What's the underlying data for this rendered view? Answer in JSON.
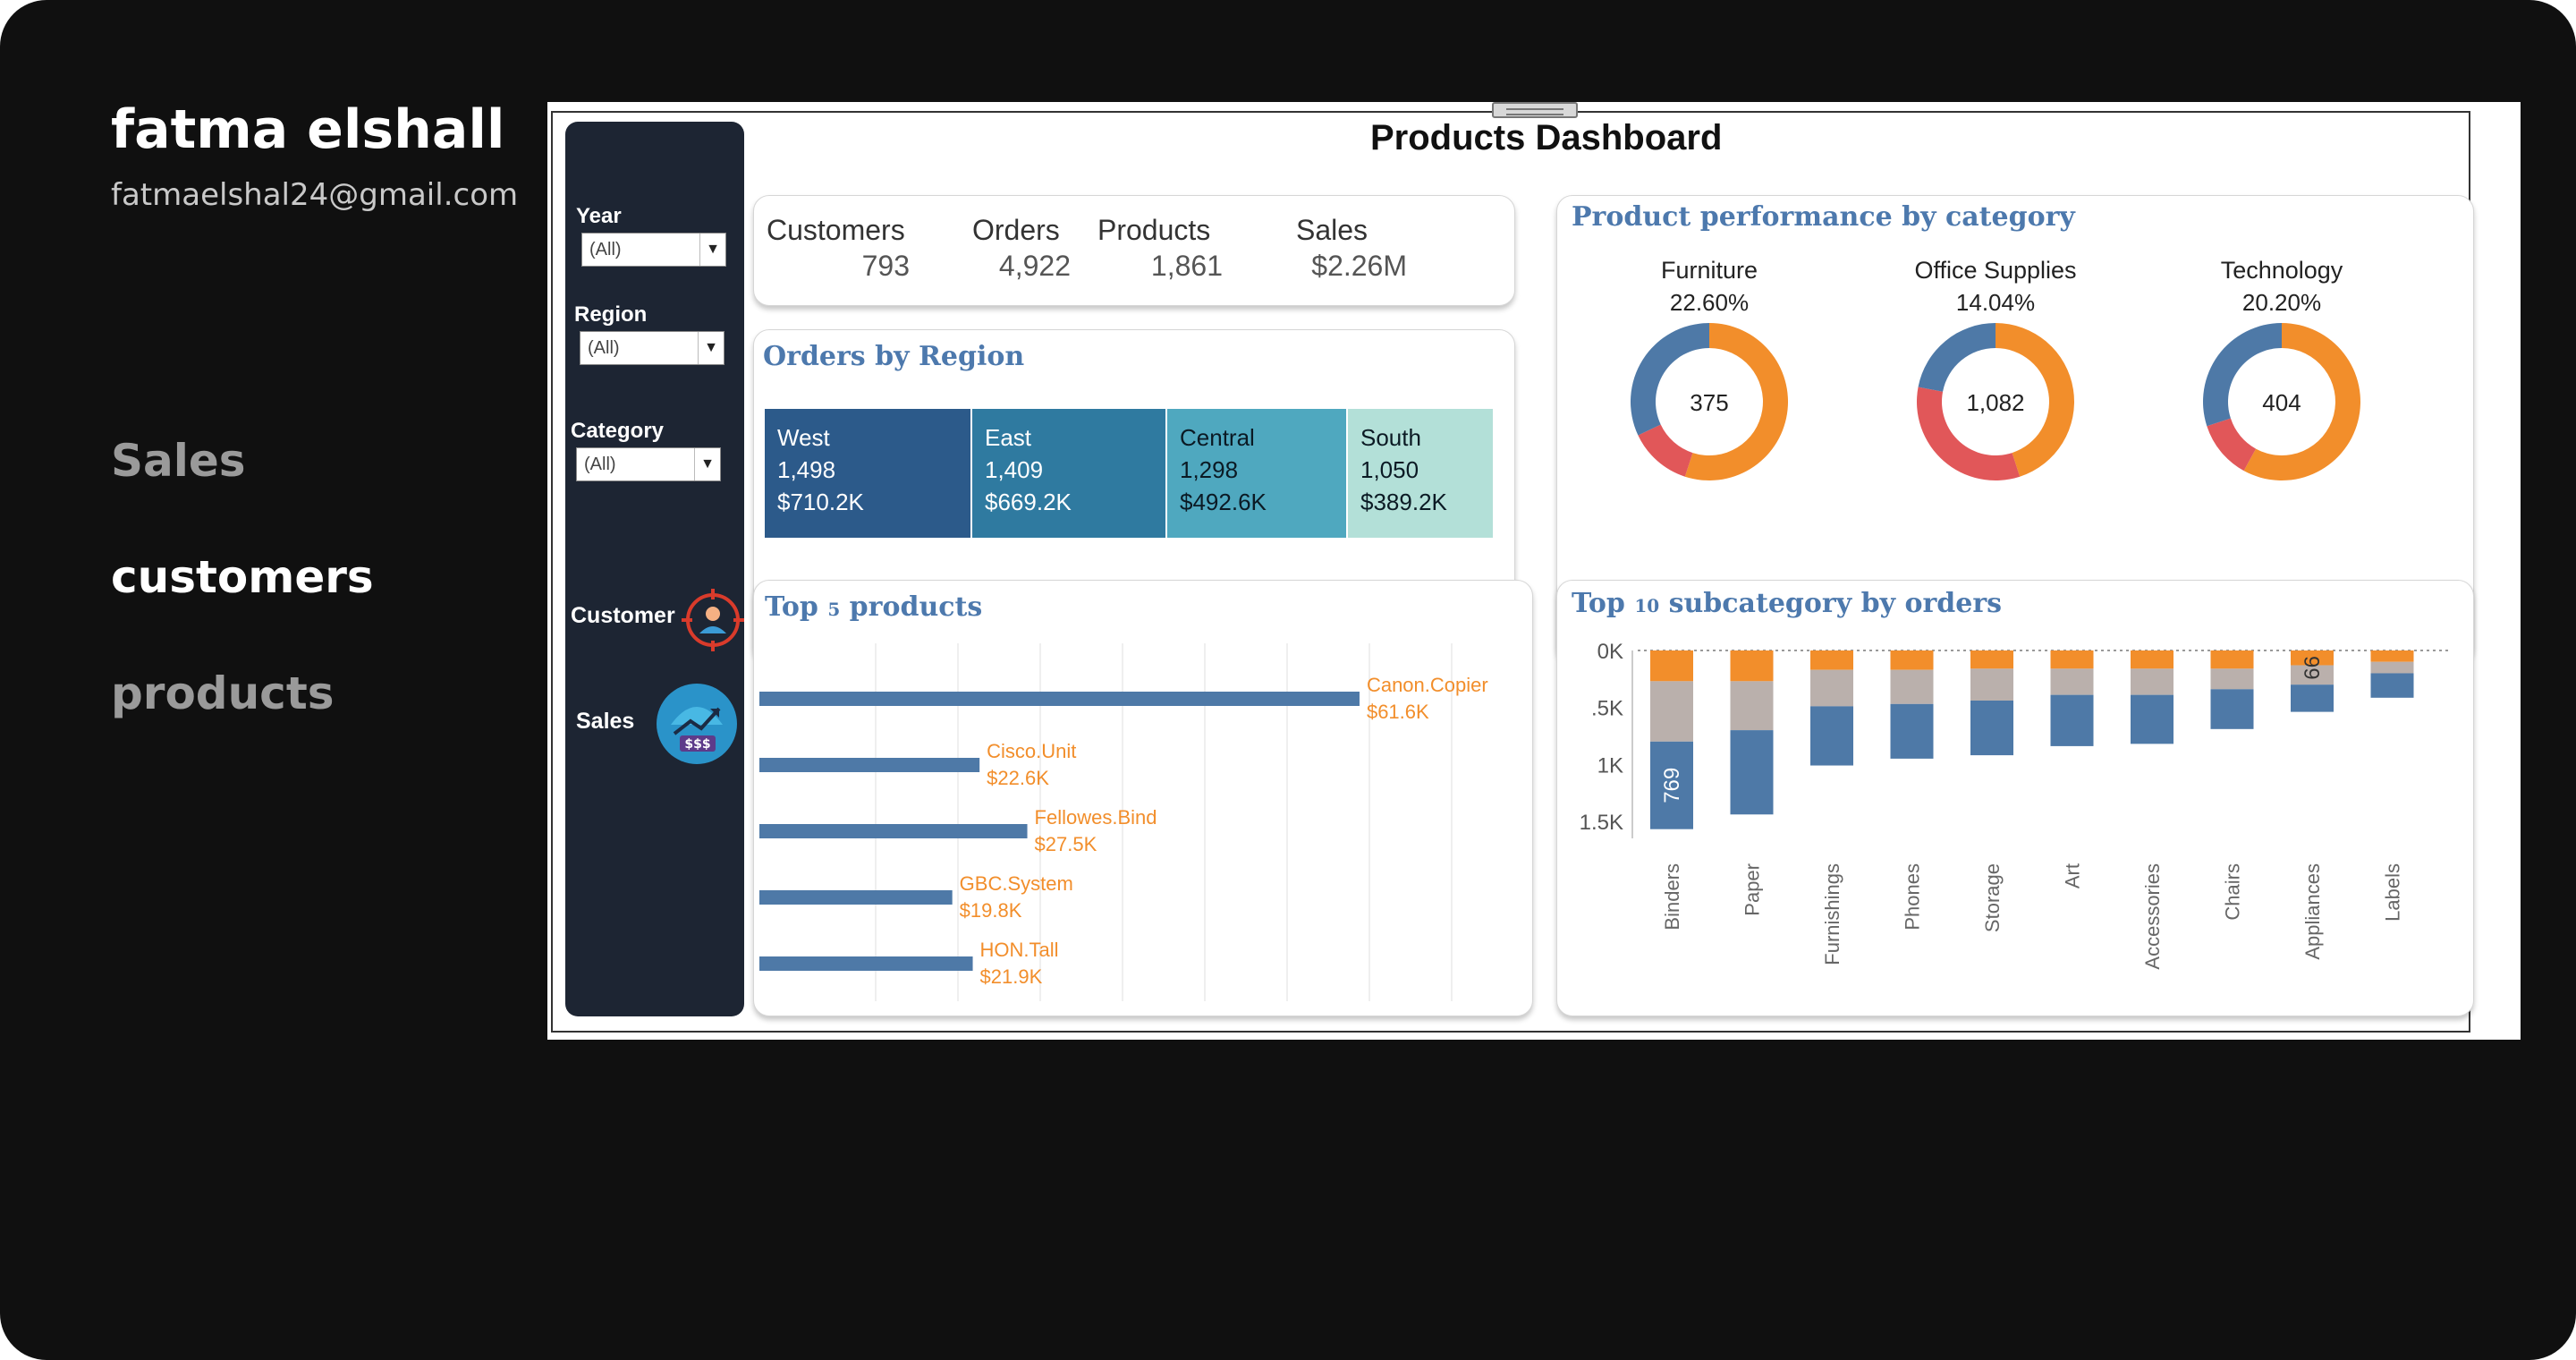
{
  "profile": {
    "name": "fatma elshall",
    "email": "fatmaelshal24@gmail.com"
  },
  "nav": {
    "sales": "Sales",
    "customers": "customers",
    "products": "products"
  },
  "dashboard": {
    "title": "Products Dashboard",
    "filters": {
      "year_label": "Year",
      "year_value": "(All)",
      "region_label": "Region",
      "region_value": "(All)",
      "category_label": "Category",
      "category_value": "(All)",
      "customer_label": "Customer",
      "sales_label": "Sales"
    },
    "kpis": {
      "customers_label": "Customers",
      "customers_value": "793",
      "orders_label": "Orders",
      "orders_value": "4,922",
      "products_label": "Products",
      "products_value": "1,861",
      "sales_label": "Sales",
      "sales_value": "$2.26M"
    },
    "orders_by_region": {
      "title": "Orders by Region",
      "regions": [
        {
          "name": "West",
          "orders": "1,498",
          "sales": "$710.2K",
          "color": "#2c5a8a"
        },
        {
          "name": "East",
          "orders": "1,409",
          "sales": "$669.2K",
          "color": "#2f7aa0"
        },
        {
          "name": "Central",
          "orders": "1,298",
          "sales": "$492.6K",
          "color": "#4fa8bf"
        },
        {
          "name": "South",
          "orders": "1,050",
          "sales": "$389.2K",
          "color": "#b3e0d8"
        }
      ]
    },
    "category_perf": {
      "title": "Product performance by category",
      "items": [
        {
          "name": "Furniture",
          "pct": "22.60%",
          "center": "375"
        },
        {
          "name": "Office Supplies",
          "pct": "14.04%",
          "center": "1,082"
        },
        {
          "name": "Technology",
          "pct": "20.20%",
          "center": "404"
        }
      ]
    },
    "top_products": {
      "title_pre": "Top ",
      "title_num": "5",
      "title_post": " products",
      "items": [
        {
          "name": "Canon.Copier",
          "sales": "$61.6K"
        },
        {
          "name": "Cisco.Unit",
          "sales": "$22.6K"
        },
        {
          "name": "Fellowes.Bind",
          "sales": "$27.5K"
        },
        {
          "name": "GBC.System",
          "sales": "$19.8K"
        },
        {
          "name": "HON.Tall",
          "sales": "$21.9K"
        }
      ]
    },
    "top_subcat": {
      "title_pre": "Top ",
      "title_num": "10",
      "title_post": " subcategory by orders"
    }
  },
  "chart_data": [
    {
      "type": "pie",
      "title": "Product performance by category",
      "series": [
        {
          "name": "Furniture",
          "slices": [
            {
              "value": 55,
              "color": "#f28e2b"
            },
            {
              "value": 13,
              "color": "#e15759"
            },
            {
              "value": 32,
              "color": "#4e79a7"
            }
          ]
        },
        {
          "name": "Office Supplies",
          "slices": [
            {
              "value": 45,
              "color": "#f28e2b"
            },
            {
              "value": 33,
              "color": "#e15759"
            },
            {
              "value": 22,
              "color": "#4e79a7"
            }
          ]
        },
        {
          "name": "Technology",
          "slices": [
            {
              "value": 58,
              "color": "#f28e2b"
            },
            {
              "value": 12,
              "color": "#e15759"
            },
            {
              "value": 30,
              "color": "#4e79a7"
            }
          ]
        }
      ]
    },
    {
      "type": "bar",
      "title": "Top 5 products",
      "categories": [
        "Canon.Copier",
        "Cisco.Unit",
        "Fellowes.Bind",
        "GBC.System",
        "HON.Tall"
      ],
      "values": [
        61.6,
        22.6,
        27.5,
        19.8,
        21.9
      ],
      "xlim": [
        0,
        65
      ]
    },
    {
      "type": "bar",
      "title": "Top 10 subcategory by orders",
      "categories": [
        "Binders",
        "Paper",
        "Furnishings",
        "Phones",
        "Storage",
        "Art",
        "Accessories",
        "Chairs",
        "Appliances",
        "Labels"
      ],
      "ylim": [
        0,
        1650
      ],
      "y_ticks": [
        "0K",
        ".5K",
        "1K",
        "1.5K"
      ],
      "series": [
        {
          "color": "#f28e2b",
          "values": [
            270,
            270,
            170,
            170,
            160,
            160,
            160,
            160,
            130,
            100
          ]
        },
        {
          "color": "#bab0ac",
          "values": [
            530,
            430,
            320,
            300,
            280,
            230,
            230,
            180,
            170,
            100
          ]
        },
        {
          "color": "#4e79a7",
          "values": [
            769,
            740,
            520,
            480,
            480,
            450,
            430,
            350,
            239,
            215
          ]
        }
      ],
      "data_labels": {
        "Binders": "769",
        "Appliances": "66"
      }
    }
  ]
}
